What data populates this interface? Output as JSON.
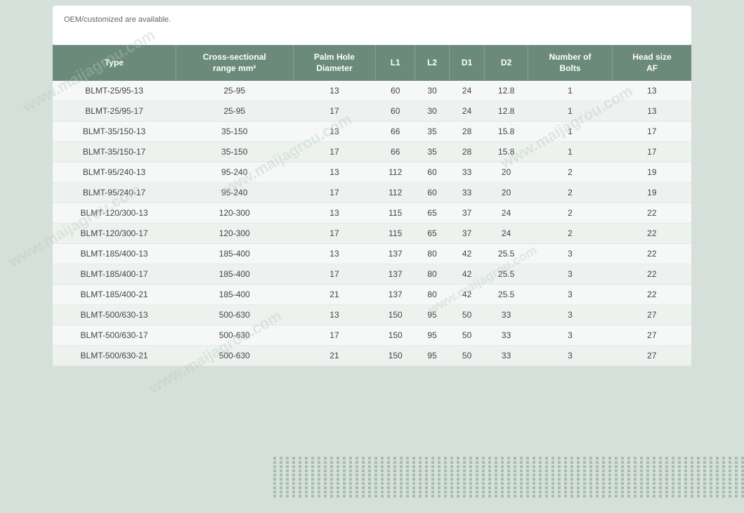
{
  "page": {
    "background_color": "#d6e0da"
  },
  "top_card": {
    "text": "OEM/customized are available."
  },
  "table": {
    "headers": [
      {
        "key": "type",
        "label": "Type"
      },
      {
        "key": "cross_section",
        "label": "Cross-sectional range mm²"
      },
      {
        "key": "palm_hole",
        "label": "Palm Hole Diameter"
      },
      {
        "key": "l1",
        "label": "L1"
      },
      {
        "key": "l2",
        "label": "L2"
      },
      {
        "key": "d1",
        "label": "D1"
      },
      {
        "key": "d2",
        "label": "D2"
      },
      {
        "key": "num_bolts",
        "label": "Number of Bolts"
      },
      {
        "key": "head_size",
        "label": "Head size AF"
      }
    ],
    "rows": [
      {
        "type": "BLMT-25/95-13",
        "cross_section": "25-95",
        "palm_hole": "13",
        "l1": "60",
        "l2": "30",
        "d1": "24",
        "d2": "12.8",
        "num_bolts": "1",
        "head_size": "13"
      },
      {
        "type": "BLMT-25/95-17",
        "cross_section": "25-95",
        "palm_hole": "17",
        "l1": "60",
        "l2": "30",
        "d1": "24",
        "d2": "12.8",
        "num_bolts": "1",
        "head_size": "13"
      },
      {
        "type": "BLMT-35/150-13",
        "cross_section": "35-150",
        "palm_hole": "13",
        "l1": "66",
        "l2": "35",
        "d1": "28",
        "d2": "15.8",
        "num_bolts": "1",
        "head_size": "17"
      },
      {
        "type": "BLMT-35/150-17",
        "cross_section": "35-150",
        "palm_hole": "17",
        "l1": "66",
        "l2": "35",
        "d1": "28",
        "d2": "15.8",
        "num_bolts": "1",
        "head_size": "17"
      },
      {
        "type": "BLMT-95/240-13",
        "cross_section": "95-240",
        "palm_hole": "13",
        "l1": "112",
        "l2": "60",
        "d1": "33",
        "d2": "20",
        "num_bolts": "2",
        "head_size": "19"
      },
      {
        "type": "BLMT-95/240-17",
        "cross_section": "95-240",
        "palm_hole": "17",
        "l1": "112",
        "l2": "60",
        "d1": "33",
        "d2": "20",
        "num_bolts": "2",
        "head_size": "19"
      },
      {
        "type": "BLMT-120/300-13",
        "cross_section": "120-300",
        "palm_hole": "13",
        "l1": "115",
        "l2": "65",
        "d1": "37",
        "d2": "24",
        "num_bolts": "2",
        "head_size": "22"
      },
      {
        "type": "BLMT-120/300-17",
        "cross_section": "120-300",
        "palm_hole": "17",
        "l1": "115",
        "l2": "65",
        "d1": "37",
        "d2": "24",
        "num_bolts": "2",
        "head_size": "22"
      },
      {
        "type": "BLMT-185/400-13",
        "cross_section": "185-400",
        "palm_hole": "13",
        "l1": "137",
        "l2": "80",
        "d1": "42",
        "d2": "25.5",
        "num_bolts": "3",
        "head_size": "22"
      },
      {
        "type": "BLMT-185/400-17",
        "cross_section": "185-400",
        "palm_hole": "17",
        "l1": "137",
        "l2": "80",
        "d1": "42",
        "d2": "25.5",
        "num_bolts": "3",
        "head_size": "22"
      },
      {
        "type": "BLMT-185/400-21",
        "cross_section": "185-400",
        "palm_hole": "21",
        "l1": "137",
        "l2": "80",
        "d1": "42",
        "d2": "25.5",
        "num_bolts": "3",
        "head_size": "22"
      },
      {
        "type": "BLMT-500/630-13",
        "cross_section": "500-630",
        "palm_hole": "13",
        "l1": "150",
        "l2": "95",
        "d1": "50",
        "d2": "33",
        "num_bolts": "3",
        "head_size": "27"
      },
      {
        "type": "BLMT-500/630-17",
        "cross_section": "500-630",
        "palm_hole": "17",
        "l1": "150",
        "l2": "95",
        "d1": "50",
        "d2": "33",
        "num_bolts": "3",
        "head_size": "27"
      },
      {
        "type": "BLMT-500/630-21",
        "cross_section": "500-630",
        "palm_hole": "21",
        "l1": "150",
        "l2": "95",
        "d1": "50",
        "d2": "33",
        "num_bolts": "3",
        "head_size": "27"
      }
    ]
  },
  "watermarks": [
    "www.maijagrou.com",
    "www.maijagrou.com",
    "www.maijagrou.com",
    "www.maijagrou.com",
    "www.maijagrou.com",
    "www.maijagrou.com"
  ]
}
